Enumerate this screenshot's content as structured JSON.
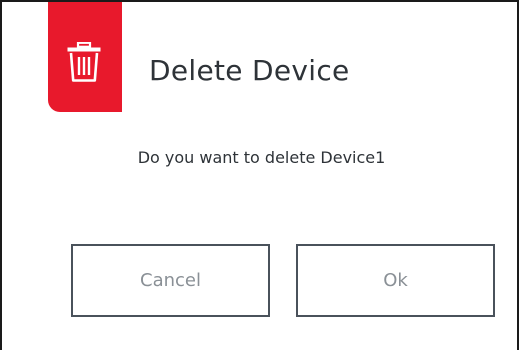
{
  "dialog": {
    "title": "Delete Device",
    "message": "Do you want to delete Device1",
    "icon": "trash-icon",
    "accent_color": "#e8192c",
    "buttons": {
      "cancel_label": "Cancel",
      "ok_label": "Ok"
    }
  }
}
